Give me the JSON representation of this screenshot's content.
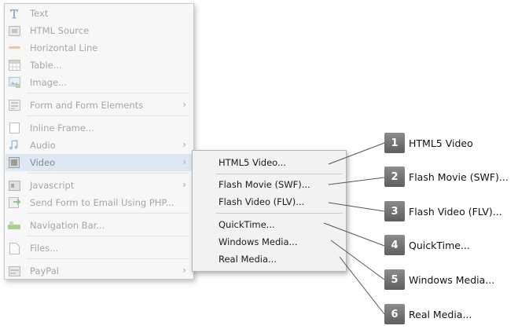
{
  "menu": {
    "items": [
      {
        "label": "Text",
        "icon": "text-icon"
      },
      {
        "label": "HTML Source",
        "icon": "html-source-icon"
      },
      {
        "label": "Horizontal Line",
        "icon": "horizontal-line-icon"
      },
      {
        "label": "Table...",
        "icon": "table-icon"
      },
      {
        "label": "Image...",
        "icon": "image-icon"
      },
      {
        "label": "Form and Form Elements",
        "icon": "form-icon"
      },
      {
        "label": "Inline Frame...",
        "icon": "inline-frame-icon"
      },
      {
        "label": "Audio",
        "icon": "audio-icon"
      },
      {
        "label": "Video",
        "icon": "video-icon"
      },
      {
        "label": "Javascript",
        "icon": "javascript-icon"
      },
      {
        "label": "Send Form to Email Using PHP...",
        "icon": "send-form-icon"
      },
      {
        "label": "Navigation Bar...",
        "icon": "navigation-bar-icon"
      },
      {
        "label": "Files...",
        "icon": "files-icon"
      },
      {
        "label": "PayPal",
        "icon": "paypal-icon"
      }
    ],
    "chevron": "›"
  },
  "submenu": {
    "items": [
      {
        "label": "HTML5 Video..."
      },
      {
        "label": "Flash Movie (SWF)..."
      },
      {
        "label": "Flash Video (FLV)..."
      },
      {
        "label": "QuickTime..."
      },
      {
        "label": "Windows Media..."
      },
      {
        "label": "Real Media..."
      }
    ]
  },
  "callouts": [
    {
      "num": "1",
      "label": "HTML5 Video"
    },
    {
      "num": "2",
      "label": "Flash Movie (SWF)..."
    },
    {
      "num": "3",
      "label": "Flash Video (FLV)..."
    },
    {
      "num": "4",
      "label": "QuickTime..."
    },
    {
      "num": "5",
      "label": "Windows Media..."
    },
    {
      "num": "6",
      "label": "Real Media..."
    }
  ],
  "colors": {
    "highlight": "#dde8f3",
    "badge": "#6e6e6e",
    "disabled_text": "#a6a6a6"
  }
}
